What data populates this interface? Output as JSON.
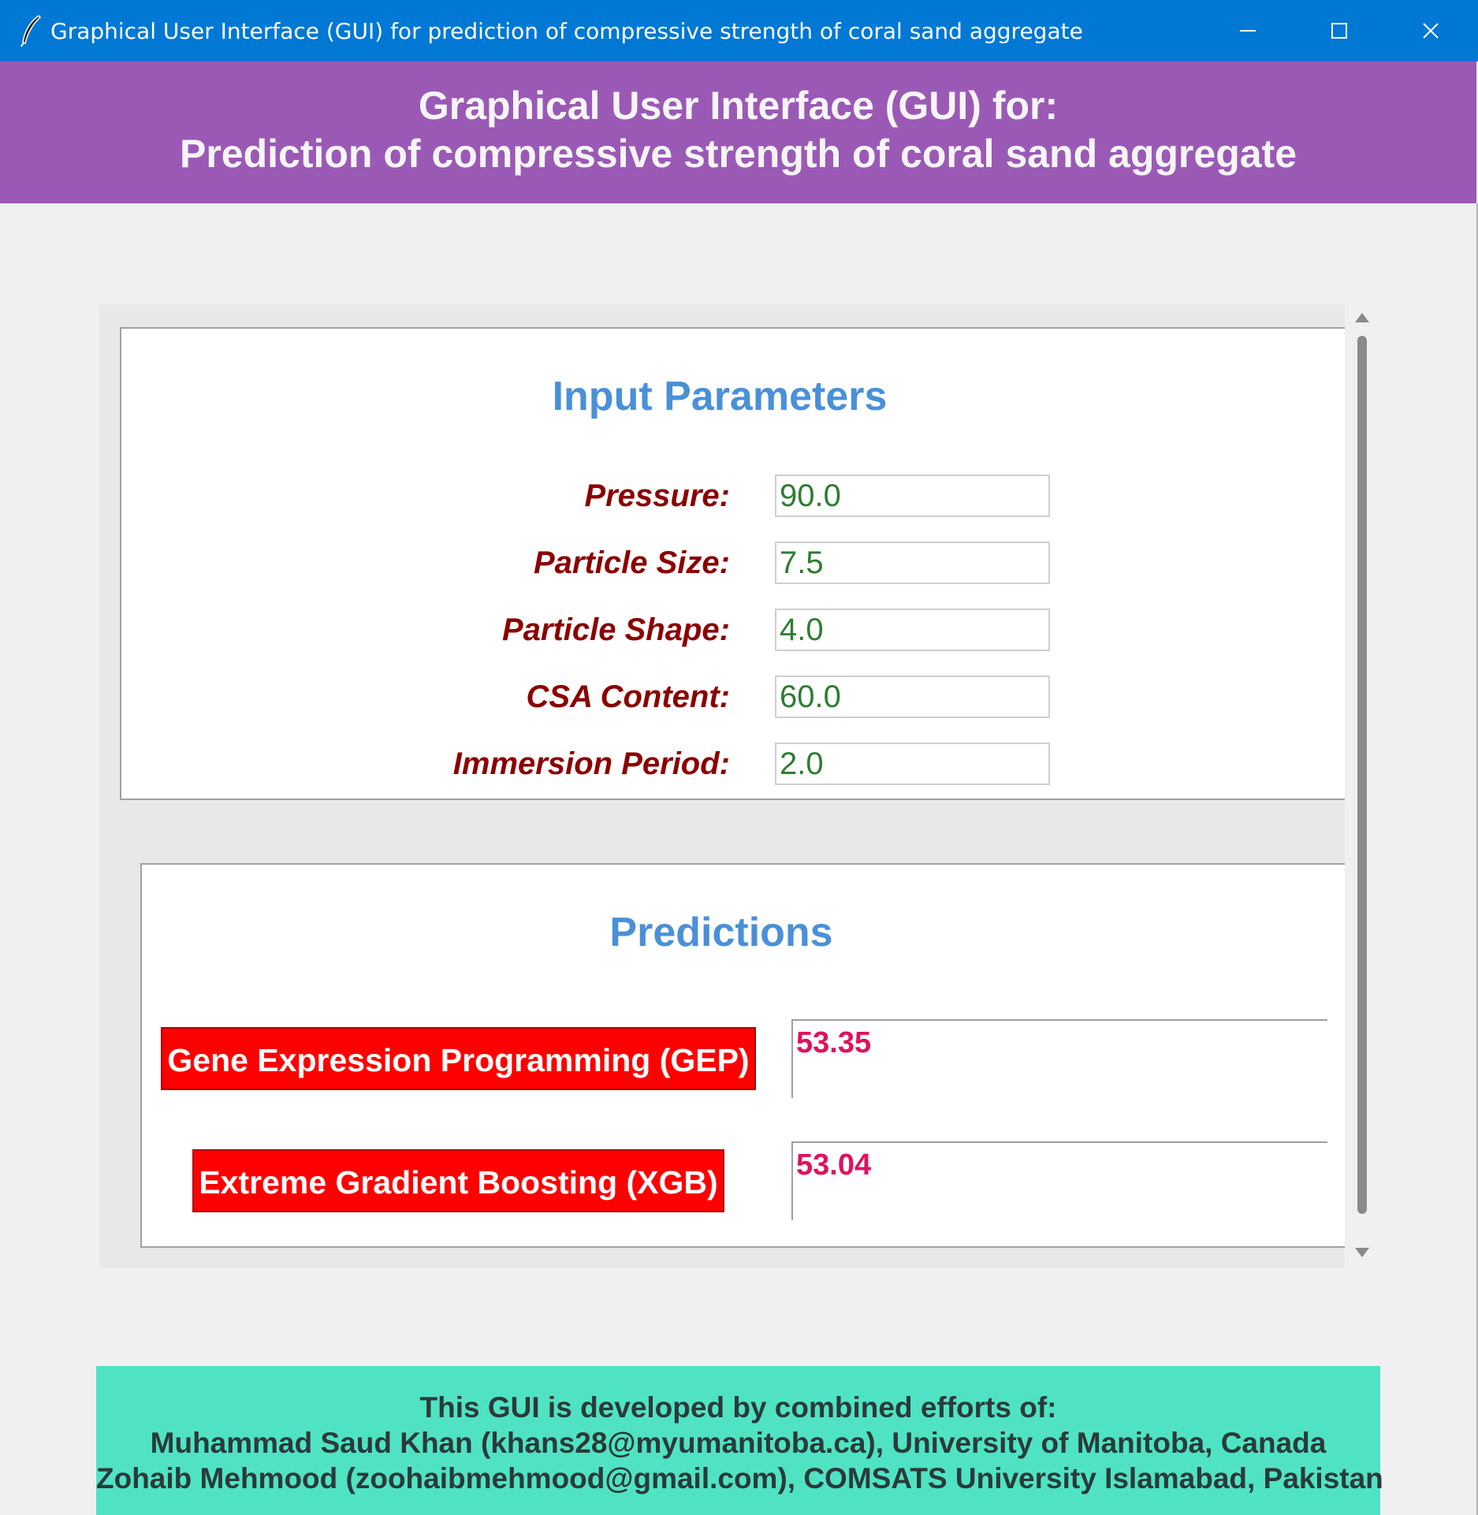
{
  "window": {
    "title": "Graphical User Interface (GUI) for prediction of compressive strength of coral sand aggregate",
    "icon": "feather-icon",
    "accent_color": "#0078d4"
  },
  "header": {
    "line1": "Graphical User Interface (GUI) for:",
    "line2": "Prediction of compressive strength of coral sand aggregate",
    "background": "#9b59b6"
  },
  "inputs": {
    "title": "Input Parameters",
    "fields": [
      {
        "label": "Pressure:",
        "value": "90.0"
      },
      {
        "label": "Particle Size:",
        "value": "7.5"
      },
      {
        "label": "Particle Shape:",
        "value": "4.0"
      },
      {
        "label": "CSA Content:",
        "value": "60.0"
      },
      {
        "label": "Immersion Period:",
        "value": "2.0"
      }
    ]
  },
  "predictions": {
    "title": "Predictions",
    "models": [
      {
        "label": "Gene Expression Programming (GEP)",
        "value": "53.35"
      },
      {
        "label": "Extreme Gradient Boosting (XGB)",
        "value": "53.04"
      }
    ],
    "button_color": "#ff0000",
    "value_color": "#e0115f"
  },
  "footer": {
    "line1": "This GUI is developed by combined efforts of:",
    "line2": "Muhammad Saud Khan (khans28@myumanitoba.ca), University of Manitoba, Canada",
    "line3": "Zohaib Mehmood (zoohaibmehmood@gmail.com), COMSATS University Islamabad, Pakistan",
    "background": "#4fe3c4"
  }
}
